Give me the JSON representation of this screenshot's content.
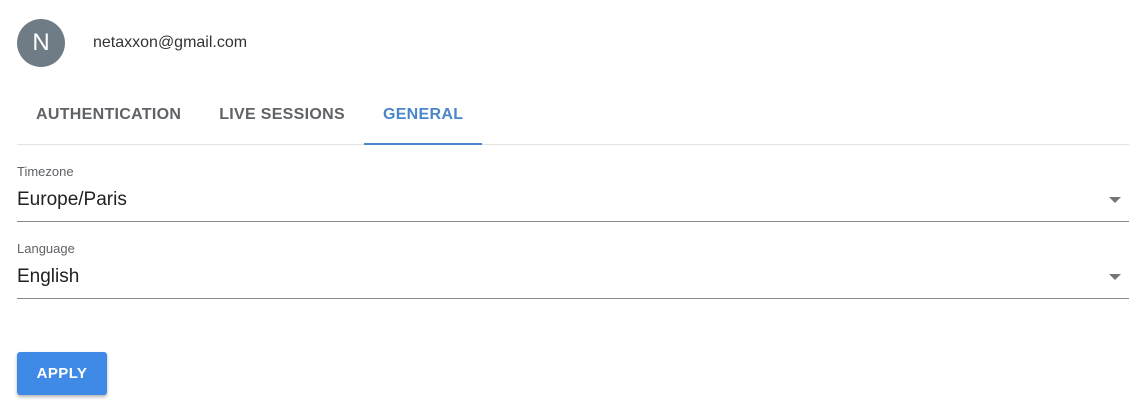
{
  "user": {
    "avatar_initial": "N",
    "email": "netaxxon@gmail.com"
  },
  "tabs": [
    {
      "label": "AUTHENTICATION",
      "active": false
    },
    {
      "label": "LIVE SESSIONS",
      "active": false
    },
    {
      "label": "GENERAL",
      "active": true
    }
  ],
  "form": {
    "timezone": {
      "label": "Timezone",
      "value": "Europe/Paris"
    },
    "language": {
      "label": "Language",
      "value": "English"
    }
  },
  "actions": {
    "apply_label": "APPLY"
  },
  "colors": {
    "accent": "#4a86c8",
    "button": "#3f8ae6",
    "avatar_bg": "#6f7c85"
  }
}
